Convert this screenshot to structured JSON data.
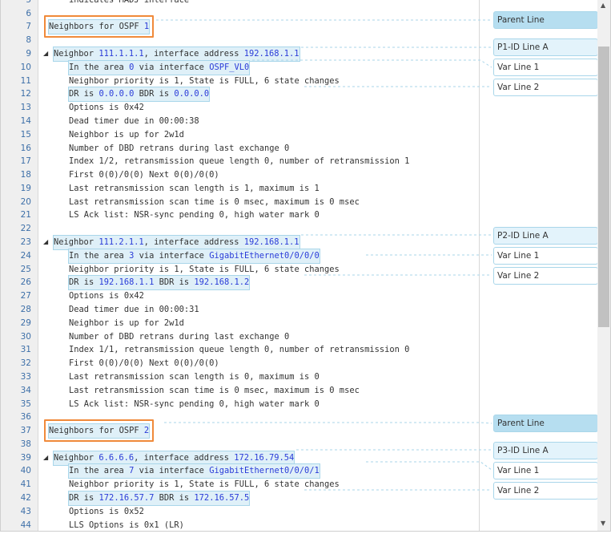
{
  "code_lines": [
    {
      "n": "5",
      "indent": 2,
      "parts": [
        [
          "indicates MADJ interface",
          ""
        ]
      ]
    },
    {
      "n": "6",
      "indent": 0,
      "parts": []
    },
    {
      "n": "7",
      "indent": 0,
      "hl": true,
      "parts": [
        [
          "Neighbors for OSPF ",
          ""
        ],
        [
          "1",
          "num"
        ]
      ]
    },
    {
      "n": "8",
      "indent": 0,
      "parts": []
    },
    {
      "n": "9",
      "indent": 1,
      "hl": true,
      "tri": true,
      "parts": [
        [
          "Neighbor ",
          ""
        ],
        [
          "111.1.1.1",
          "num"
        ],
        [
          ", interface address ",
          ""
        ],
        [
          "192.168.1.1",
          "num"
        ]
      ]
    },
    {
      "n": "10",
      "indent": 2,
      "hl": true,
      "parts": [
        [
          "In the area ",
          ""
        ],
        [
          "0",
          "num"
        ],
        [
          " via interface ",
          ""
        ],
        [
          "OSPF_VL0",
          "num"
        ]
      ]
    },
    {
      "n": "11",
      "indent": 2,
      "parts": [
        [
          "Neighbor priority is 1, State is FULL, 6 state changes",
          ""
        ]
      ]
    },
    {
      "n": "12",
      "indent": 2,
      "hl": true,
      "parts": [
        [
          "DR is ",
          ""
        ],
        [
          "0.0.0.0",
          "num"
        ],
        [
          " BDR is ",
          ""
        ],
        [
          "0.0.0.0",
          "num"
        ]
      ]
    },
    {
      "n": "13",
      "indent": 2,
      "parts": [
        [
          "Options is 0x42",
          ""
        ]
      ]
    },
    {
      "n": "14",
      "indent": 2,
      "parts": [
        [
          "Dead timer due in 00:00:38",
          ""
        ]
      ]
    },
    {
      "n": "15",
      "indent": 2,
      "parts": [
        [
          "Neighbor is up for 2w1d",
          ""
        ]
      ]
    },
    {
      "n": "16",
      "indent": 2,
      "parts": [
        [
          "Number of DBD retrans during last exchange 0",
          ""
        ]
      ]
    },
    {
      "n": "17",
      "indent": 2,
      "parts": [
        [
          "Index 1/2, retransmission queue length 0, number of retransmission 1",
          ""
        ]
      ]
    },
    {
      "n": "18",
      "indent": 2,
      "parts": [
        [
          "First 0(0)/0(0) Next 0(0)/0(0)",
          ""
        ]
      ]
    },
    {
      "n": "19",
      "indent": 2,
      "parts": [
        [
          "Last retransmission scan length is 1, maximum is 1",
          ""
        ]
      ]
    },
    {
      "n": "20",
      "indent": 2,
      "parts": [
        [
          "Last retransmission scan time is 0 msec, maximum is 0 msec",
          ""
        ]
      ]
    },
    {
      "n": "21",
      "indent": 2,
      "parts": [
        [
          "LS Ack list: NSR-sync pending 0, high water mark 0",
          ""
        ]
      ]
    },
    {
      "n": "22",
      "indent": 0,
      "parts": []
    },
    {
      "n": "23",
      "indent": 1,
      "hl": true,
      "tri": true,
      "parts": [
        [
          "Neighbor ",
          ""
        ],
        [
          "111.2.1.1",
          "num"
        ],
        [
          ", interface address ",
          ""
        ],
        [
          "192.168.1.1",
          "num"
        ]
      ]
    },
    {
      "n": "24",
      "indent": 2,
      "hl": true,
      "parts": [
        [
          "In the area ",
          ""
        ],
        [
          "3",
          "num"
        ],
        [
          " via interface ",
          ""
        ],
        [
          "GigabitEthernet0/0/0/0",
          "num"
        ]
      ]
    },
    {
      "n": "25",
      "indent": 2,
      "parts": [
        [
          "Neighbor priority is 1, State is FULL, 6 state changes",
          ""
        ]
      ]
    },
    {
      "n": "26",
      "indent": 2,
      "hl": true,
      "parts": [
        [
          "DR is ",
          ""
        ],
        [
          "192.168.1.1",
          "num"
        ],
        [
          " BDR is ",
          ""
        ],
        [
          "192.168.1.2",
          "num"
        ]
      ]
    },
    {
      "n": "27",
      "indent": 2,
      "parts": [
        [
          "Options is 0x42",
          ""
        ]
      ]
    },
    {
      "n": "28",
      "indent": 2,
      "parts": [
        [
          "Dead timer due in 00:00:31",
          ""
        ]
      ]
    },
    {
      "n": "29",
      "indent": 2,
      "parts": [
        [
          "Neighbor is up for 2w1d",
          ""
        ]
      ]
    },
    {
      "n": "30",
      "indent": 2,
      "parts": [
        [
          "Number of DBD retrans during last exchange 0",
          ""
        ]
      ]
    },
    {
      "n": "31",
      "indent": 2,
      "parts": [
        [
          "Index 1/1, retransmission queue length 0, number of retransmission 0",
          ""
        ]
      ]
    },
    {
      "n": "32",
      "indent": 2,
      "parts": [
        [
          "First 0(0)/0(0) Next 0(0)/0(0)",
          ""
        ]
      ]
    },
    {
      "n": "33",
      "indent": 2,
      "parts": [
        [
          "Last retransmission scan length is 0, maximum is 0",
          ""
        ]
      ]
    },
    {
      "n": "34",
      "indent": 2,
      "parts": [
        [
          "Last retransmission scan time is 0 msec, maximum is 0 msec",
          ""
        ]
      ]
    },
    {
      "n": "35",
      "indent": 2,
      "parts": [
        [
          "LS Ack list: NSR-sync pending 0, high water mark 0",
          ""
        ]
      ]
    },
    {
      "n": "36",
      "indent": 0,
      "parts": []
    },
    {
      "n": "37",
      "indent": 0,
      "hl": true,
      "parts": [
        [
          "Neighbors for OSPF ",
          ""
        ],
        [
          "2",
          "num"
        ]
      ]
    },
    {
      "n": "38",
      "indent": 0,
      "parts": []
    },
    {
      "n": "39",
      "indent": 1,
      "hl": true,
      "tri": true,
      "parts": [
        [
          "Neighbor ",
          ""
        ],
        [
          "6.6.6.6",
          "num"
        ],
        [
          ", interface address ",
          ""
        ],
        [
          "172.16.79.54",
          "num"
        ]
      ]
    },
    {
      "n": "40",
      "indent": 2,
      "hl": true,
      "parts": [
        [
          "In the area ",
          ""
        ],
        [
          "7",
          "num"
        ],
        [
          " via interface ",
          ""
        ],
        [
          "GigabitEthernet0/0/0/1",
          "num"
        ]
      ]
    },
    {
      "n": "41",
      "indent": 2,
      "parts": [
        [
          "Neighbor priority is 1, State is FULL, 6 state changes",
          ""
        ]
      ]
    },
    {
      "n": "42",
      "indent": 2,
      "hl": true,
      "parts": [
        [
          "DR is ",
          ""
        ],
        [
          "172.16.57.7",
          "num"
        ],
        [
          " BDR is ",
          ""
        ],
        [
          "172.16.57.5",
          "num"
        ]
      ]
    },
    {
      "n": "43",
      "indent": 2,
      "parts": [
        [
          "Options is 0x52",
          ""
        ]
      ]
    },
    {
      "n": "44",
      "indent": 2,
      "parts": [
        [
          "LLS Options is 0x1 (LR)",
          ""
        ]
      ]
    }
  ],
  "panel": [
    {
      "label": "Parent Line",
      "kind": "parent"
    },
    {
      "label": "P1-ID Line A",
      "kind": "pid"
    },
    {
      "label": "Var Line 1",
      "kind": "var"
    },
    {
      "label": "Var Line 2",
      "kind": "var"
    },
    {
      "label": "P2-ID Line A",
      "kind": "pid"
    },
    {
      "label": "Var Line 1",
      "kind": "var"
    },
    {
      "label": "Var Line 2",
      "kind": "var"
    },
    {
      "label": "Parent Line",
      "kind": "parent"
    },
    {
      "label": "P3-ID Line A",
      "kind": "pid"
    },
    {
      "label": "Var Line 1",
      "kind": "var"
    },
    {
      "label": "Var Line 2",
      "kind": "var"
    }
  ],
  "colors": {
    "highlight": "#dff0f8",
    "number": "#2a3bd8",
    "parent_box": "#b6def0",
    "callout": "#f08a3a"
  },
  "icons": {
    "collapse": "triangle-collapse-icon",
    "scroll_up": "scroll-up-arrow-icon",
    "scroll_down": "scroll-down-arrow-icon"
  }
}
